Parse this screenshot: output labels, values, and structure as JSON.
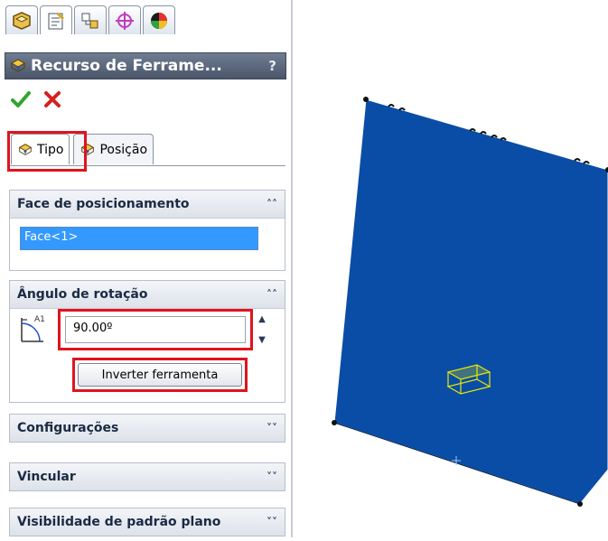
{
  "colors": {
    "plate": "#0a4da6",
    "highlight_red": "#e0141e",
    "selection_blue": "#3399ff",
    "tool_yellow": "#e8e800"
  },
  "icon_tabs": [
    {
      "icon": "feature-manager-icon"
    },
    {
      "icon": "property-manager-icon"
    },
    {
      "icon": "configuration-manager-icon"
    },
    {
      "icon": "dimxpert-manager-icon"
    },
    {
      "icon": "display-manager-icon"
    }
  ],
  "property_manager": {
    "title": "Recurso de Ferrame...",
    "help": "?",
    "ok_icon": "check-icon",
    "cancel_icon": "x-icon",
    "tabs": [
      {
        "label": "Tipo",
        "active": true
      },
      {
        "label": "Posição",
        "active": false
      }
    ],
    "groups": {
      "face": {
        "title": "Face de posicionamento",
        "value": "Face<1>"
      },
      "angle": {
        "title": "Ângulo de rotação",
        "label": "A1",
        "value": "90.00º",
        "button": "Inverter ferramenta"
      },
      "config": {
        "title": "Configurações"
      },
      "link": {
        "title": "Vincular"
      },
      "visibility": {
        "title": "Visibilidade de padrão plano"
      }
    }
  }
}
